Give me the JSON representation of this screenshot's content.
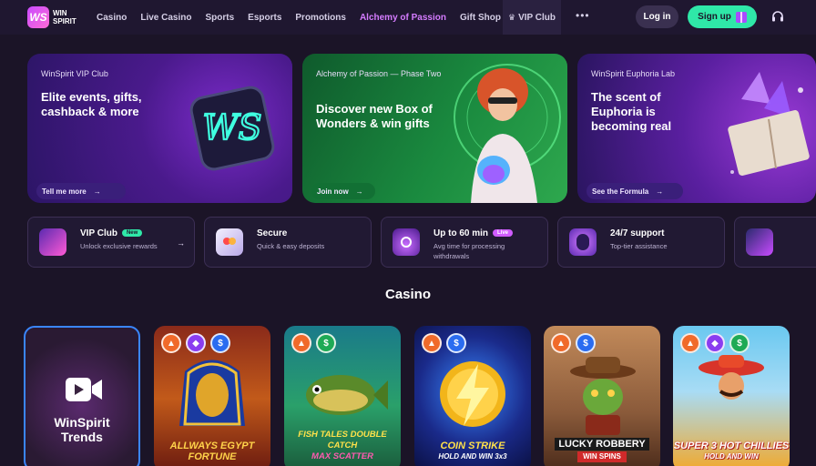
{
  "nav": {
    "logo_line1": "WIN",
    "logo_line2": "SPIRIT",
    "logo_mark": "WS",
    "links": [
      "Casino",
      "Live Casino",
      "Sports",
      "Esports",
      "Promotions",
      "Alchemy of Passion",
      "Gift Shop"
    ],
    "vip_club": "VIP Club",
    "more": "•••",
    "login": "Log in",
    "signup": "Sign up"
  },
  "banners": [
    {
      "kicker": "WinSpirit VIP Club",
      "title": "Elite events, gifts, cashback & more",
      "cta": "Tell me more"
    },
    {
      "kicker": "Alchemy of Passion — Phase Two",
      "title": "Discover new Box of Wonders & win gifts",
      "cta": "Join now"
    },
    {
      "kicker": "WinSpirit Euphoria Lab",
      "title": "The scent of Euphoria is becoming real",
      "cta": "See the Formula"
    }
  ],
  "banner_art_text": "WS",
  "features": [
    {
      "title": "VIP Club",
      "badge": "New",
      "sub": "Unlock exclusive rewards",
      "arrow": "→"
    },
    {
      "title": "Secure",
      "sub": "Quick & easy deposits"
    },
    {
      "title": "Up to 60 min",
      "badge": "Live",
      "sub": "Avg time for processing withdrawals"
    },
    {
      "title": "24/7 support",
      "sub": "Top-tier assistance"
    }
  ],
  "section": {
    "casino": "Casino"
  },
  "games": [
    {
      "label_line1": "WinSpirit",
      "label_line2": "Trends",
      "tags": []
    },
    {
      "label_line1": "ALLWAYS EGYPT",
      "label_line2": "FORTUNE",
      "tags": [
        "fire-icon",
        "gem-icon",
        "swap-icon"
      ]
    },
    {
      "label_line1": "FISH TALES DOUBLE CATCH",
      "label_line2": "MAX SCATTER",
      "tags": [
        "fire-icon",
        "money-icon"
      ]
    },
    {
      "label_line1": "COIN STRIKE",
      "label_line2": "HOLD AND WIN 3x3",
      "tags": [
        "fire-icon",
        "swap-icon"
      ]
    },
    {
      "label_line1": "LUCKY ROBBERY",
      "label_line2": "WIN SPINS",
      "tags": [
        "fire-icon",
        "swap-icon"
      ]
    },
    {
      "label_line1": "SUPER 3 HOT CHILLIES",
      "label_line2": "HOLD AND WIN",
      "tags": [
        "fire-icon",
        "gem-icon",
        "money-icon"
      ]
    }
  ],
  "colors": {
    "background": "#1b1427",
    "accent_purple": "#d57cff",
    "signup_green": "#2fe8a8",
    "card_border": "#3c2f55"
  }
}
